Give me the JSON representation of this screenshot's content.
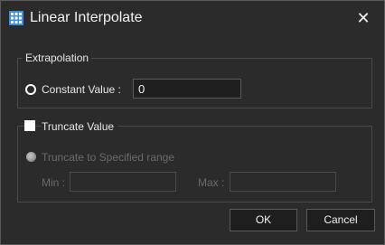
{
  "window": {
    "title": "Linear Interpolate",
    "icon": "grid-icon",
    "close_glyph": "✕"
  },
  "extrapolation": {
    "legend": "Extrapolation",
    "constant_value_label": "Constant Value :",
    "constant_value": "0",
    "constant_selected": true
  },
  "truncate": {
    "checkbox_label": "Truncate Value",
    "checked": false,
    "range_option_label": "Truncate to Specified range",
    "min_label": "Min :",
    "min_value": "",
    "max_label": "Max :",
    "max_value": "",
    "enabled": false
  },
  "buttons": {
    "ok": "OK",
    "cancel": "Cancel"
  },
  "colors": {
    "background": "#2b2b2b",
    "text": "#e8e8e8",
    "disabled_text": "#6a6a6a",
    "icon_blue": "#3a8ee6"
  }
}
